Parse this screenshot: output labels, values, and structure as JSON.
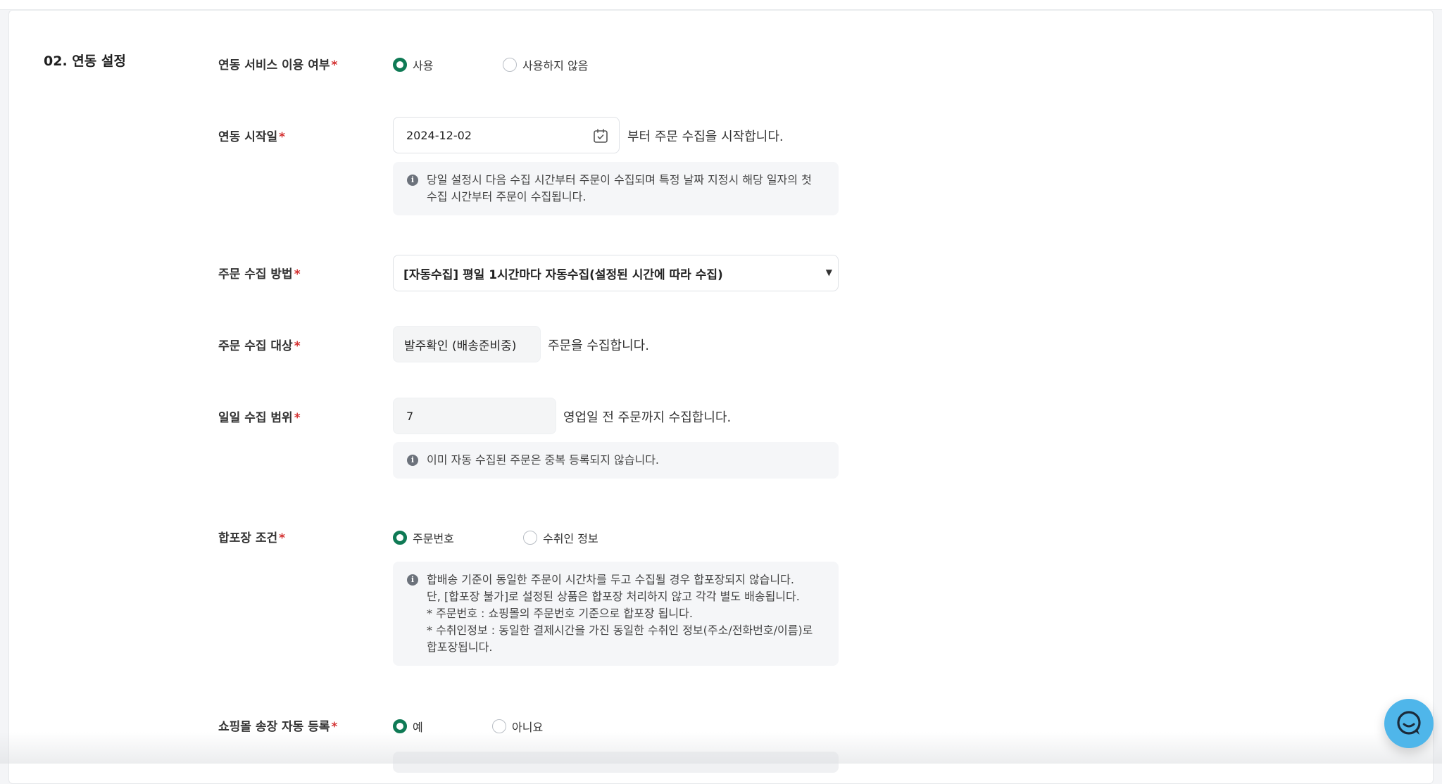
{
  "section": {
    "title": "02. 연동 설정"
  },
  "service_use": {
    "label": "연동 서비스 이용 여부",
    "options": [
      "사용",
      "사용하지 않음"
    ],
    "selected": 0
  },
  "start_date": {
    "label": "연동 시작일",
    "value": "2024-12-02",
    "suffix": "부터 주문 수집을 시작합니다.",
    "info_lines": [
      "당일 설정시 다음 수집 시간부터 주문이 수집되며 특정 날짜 지정시 해당 일자의 첫",
      "수집 시간부터 주문이 수집됩니다."
    ]
  },
  "collect_method": {
    "label": "주문 수집 방법",
    "value": "[자동수집] 평일 1시간마다 자동수집(설정된 시간에 따라 수집)"
  },
  "collect_target": {
    "label": "주문 수집 대상",
    "value": "발주확인 (배송준비중)",
    "suffix": "주문을 수집합니다."
  },
  "daily_range": {
    "label": "일일 수집 범위",
    "value": "7",
    "suffix": "영업일 전 주문까지 수집합니다.",
    "info_lines": [
      "이미 자동 수집된 주문은 중복 등록되지 않습니다."
    ]
  },
  "bundle": {
    "label": "합포장 조건",
    "options": [
      "주문번호",
      "수취인 정보"
    ],
    "selected": 0,
    "info_lines": [
      "합배송 기준이 동일한 주문이 시간차를 두고 수집될 경우 합포장되지 않습니다.",
      "단, [합포장 불가]로 설정된 상품은 합포장 처리하지 않고 각각 별도 배송됩니다.",
      "* 주문번호 : 쇼핑몰의 주문번호 기준으로 합포장 됩니다.",
      "* 수취인정보 : 동일한 결제시간을 가진 동일한 수취인 정보(주소/전화번호/이름)로",
      "합포장됩니다."
    ]
  },
  "invoice_auto": {
    "label": "쇼핑몰 송장 자동 등록",
    "options": [
      "예",
      "아니요"
    ],
    "selected": 0
  },
  "required_mark": "*",
  "icons": {
    "calendar": "calendar-icon",
    "info": "info-icon",
    "caret": "caret-down-icon",
    "chat": "chat-icon"
  },
  "colors": {
    "accent": "#0f7a55",
    "required": "#d32f2f",
    "chat": "#4fb6ea"
  }
}
